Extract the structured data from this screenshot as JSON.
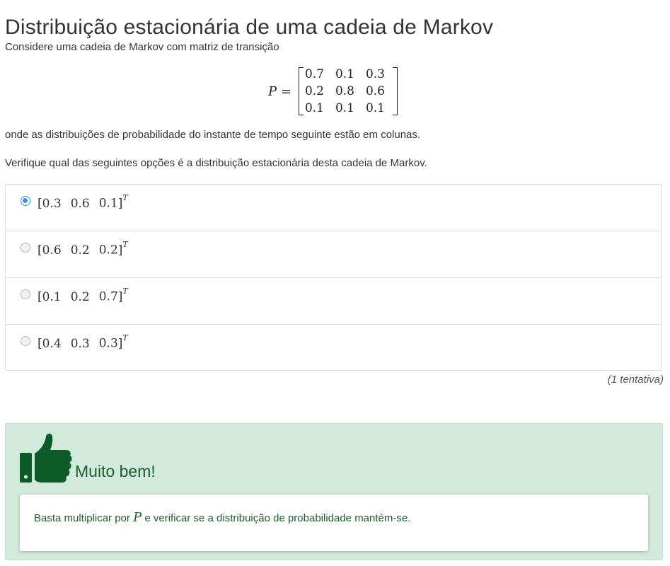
{
  "page": {
    "title": "Distribuição estacionária de uma cadeia de Markov"
  },
  "question": {
    "intro": "Considere uma cadeia de Markov com matriz de transição",
    "matrix_symbol": "P",
    "matrix_equals": "=",
    "matrix": [
      [
        "0.7",
        "0.1",
        "0.3"
      ],
      [
        "0.2",
        "0.8",
        "0.6"
      ],
      [
        "0.1",
        "0.1",
        "0.1"
      ]
    ],
    "note": "onde as distribuições de probabilidade do instante de tempo seguinte estão em colunas.",
    "prompt": "Verifique qual das seguintes opções é a distribuição estacionária desta cadeia de Markov."
  },
  "options": [
    {
      "values": [
        "0.3",
        "0.6",
        "0.1"
      ],
      "selected": true
    },
    {
      "values": [
        "0.6",
        "0.2",
        "0.2"
      ],
      "selected": false
    },
    {
      "values": [
        "0.1",
        "0.2",
        "0.7"
      ],
      "selected": false
    },
    {
      "values": [
        "0.4",
        "0.3",
        "0.3"
      ],
      "selected": false
    }
  ],
  "vector_open": "[",
  "vector_close": "]",
  "transpose": "T",
  "attempts": "(1 tentativa)",
  "feedback": {
    "icon": "thumbs-up-icon",
    "title": "Muito bem!",
    "text_before": "Basta multiplicar por ",
    "text_symbol": "P",
    "text_after": " e verificar se a distribuição de probabilidade mantém-se.",
    "colors": {
      "background": "#d1eadb",
      "text": "#1e5c32",
      "icon": "#0e5b2a"
    }
  },
  "colors": {
    "radio_selected": "#3b8ee0"
  }
}
